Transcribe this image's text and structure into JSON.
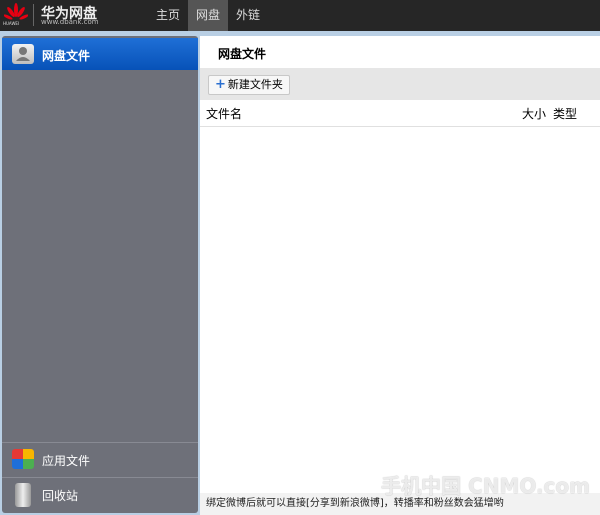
{
  "header": {
    "logo_text": "HUAWEI",
    "brand": "华为网盘",
    "url": "www.dbank.com",
    "nav": [
      {
        "label": "主页"
      },
      {
        "label": "网盘"
      },
      {
        "label": "外链"
      }
    ]
  },
  "sidebar": {
    "items": [
      {
        "label": "网盘文件",
        "icon": "user-drive-icon"
      },
      {
        "label": "应用文件",
        "icon": "apps-icon"
      },
      {
        "label": "回收站",
        "icon": "trash-icon"
      }
    ]
  },
  "main": {
    "title": "网盘文件",
    "new_folder": "新建文件夹",
    "columns": [
      "文件名",
      "大小",
      "类型"
    ],
    "status": "绑定微博后就可以直接[分享到新浪微博]，转播率和粉丝数会猛增哟"
  },
  "watermark": "手机中国 CNMO.com"
}
